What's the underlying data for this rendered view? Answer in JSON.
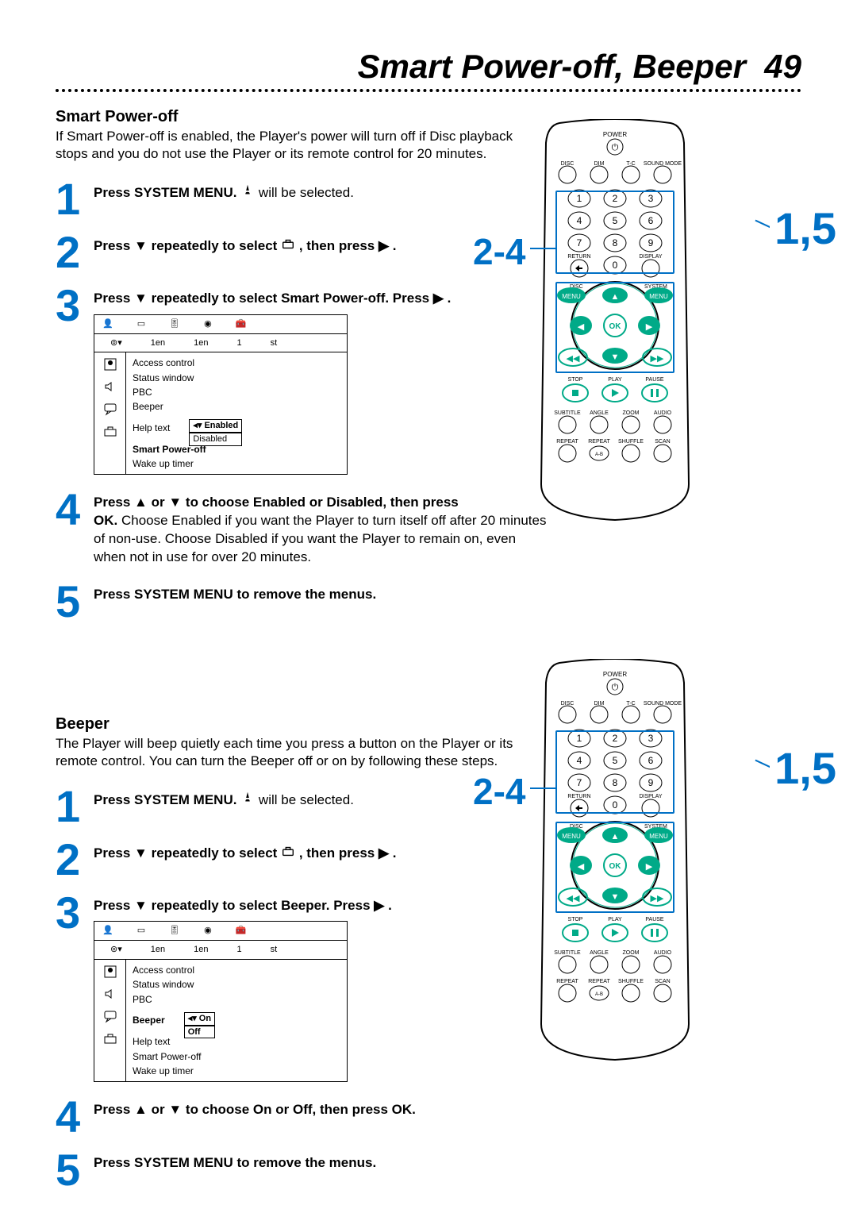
{
  "page": {
    "title": "Smart Power-off, Beeper",
    "pageNumber": "49"
  },
  "smartPowerOff": {
    "heading": "Smart Power-off",
    "intro": "If Smart Power-off is enabled, the Player's power will turn off if Disc playback stops and you do not use the Player or its remote control for 20 minutes.",
    "step1": {
      "pre": "Press ",
      "bold": "SYSTEM MENU",
      "after": ".  ",
      "suffix": " will be selected."
    },
    "step2": {
      "pre": "Press ",
      "mid": " repeatedly to select ",
      "after": " , then press ",
      "end": "."
    },
    "step3": {
      "pre": "Press ",
      "mid": " repeatedly to select Smart Power-off. Press ",
      "end": "."
    },
    "step4": {
      "line1_pre": "Press ",
      "line1_mid": " or ",
      "line1_post": " to choose Enabled or Disabled, then press",
      "line2_bold": "OK.",
      "line2_rest": " Choose Enabled if you want the Player to turn itself off after 20 minutes of non-use. Choose Disabled if you want the Player to remain on, even when not in use for over 20 minutes."
    },
    "step5": {
      "pre": "Press ",
      "bold": "SYSTEM MENU",
      "after": " to remove the menus."
    },
    "menu": {
      "headerVals": [
        "1en",
        "1en",
        "1",
        "st"
      ],
      "items": [
        "Access control",
        "Status window",
        "PBC",
        "Beeper",
        "Help text",
        "Smart Power-off",
        "Wake up timer"
      ],
      "selectedIndex": 5,
      "options": [
        "Enabled",
        "Disabled"
      ]
    }
  },
  "beeper": {
    "heading": "Beeper",
    "intro": "The Player will beep quietly each time you press a button on the Player or its remote control. You can turn the Beeper off or on by following these steps.",
    "step1": {
      "pre": "Press ",
      "bold": "SYSTEM MENU",
      "after": ".  ",
      "suffix": " will be selected."
    },
    "step2": {
      "pre": "Press ",
      "mid": " repeatedly to select ",
      "after": ", then press ",
      "end": "."
    },
    "step3": {
      "pre": "Press ",
      "mid": " repeatedly to select Beeper. Press ",
      "end": "."
    },
    "step4": {
      "pre": "Press  ",
      "mid": " or ",
      "post": " to choose On or Off, then press OK."
    },
    "step5": {
      "pre": "Press ",
      "bold": "SYSTEM MENU",
      "after": " to remove the menus."
    },
    "menu": {
      "headerVals": [
        "1en",
        "1en",
        "1",
        "st"
      ],
      "items": [
        "Access control",
        "Status window",
        "PBC",
        "Beeper",
        "Help text",
        "Smart Power-off",
        "Wake up timer"
      ],
      "selectedIndex": 3,
      "options": [
        "On",
        "Off"
      ]
    }
  },
  "callouts": {
    "left": "2-4",
    "right": "1,5"
  },
  "remote": {
    "labels": {
      "power": "POWER",
      "row1": [
        "DISC",
        "DIM",
        "T-C",
        "SOUND MODE"
      ],
      "numpad": [
        "1",
        "2",
        "3",
        "4",
        "5",
        "6",
        "7",
        "8",
        "9",
        "0"
      ],
      "return": "RETURN",
      "display": "DISPLAY",
      "discMenu": "DISC MENU",
      "systemMenu": "SYSTEM MENU",
      "ok": "OK",
      "stop": "STOP",
      "play": "PLAY",
      "pause": "PAUSE",
      "row_bottom1": [
        "SUBTITLE",
        "ANGLE",
        "ZOOM",
        "AUDIO"
      ],
      "row_bottom2": [
        "REPEAT",
        "REPEAT A-B",
        "SHUFFLE",
        "SCAN"
      ]
    }
  }
}
